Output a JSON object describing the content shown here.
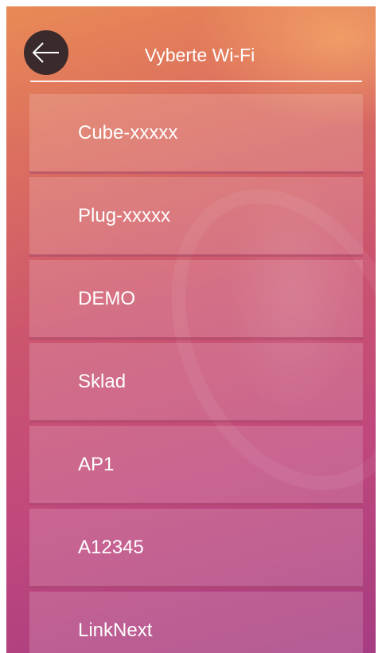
{
  "header": {
    "title": "Vyberte Wi-Fi",
    "back_icon": "arrow-left-icon"
  },
  "networks": [
    {
      "label": "Cube-xxxxx"
    },
    {
      "label": "Plug-xxxxx"
    },
    {
      "label": "DEMO"
    },
    {
      "label": "Sklad"
    },
    {
      "label": "AP1"
    },
    {
      "label": "A12345"
    },
    {
      "label": "LinkNext"
    }
  ],
  "colors": {
    "background_top": "#e98a55",
    "background_bottom": "#a63c82",
    "back_button": "#3b2a2c",
    "text": "#ffffff"
  }
}
